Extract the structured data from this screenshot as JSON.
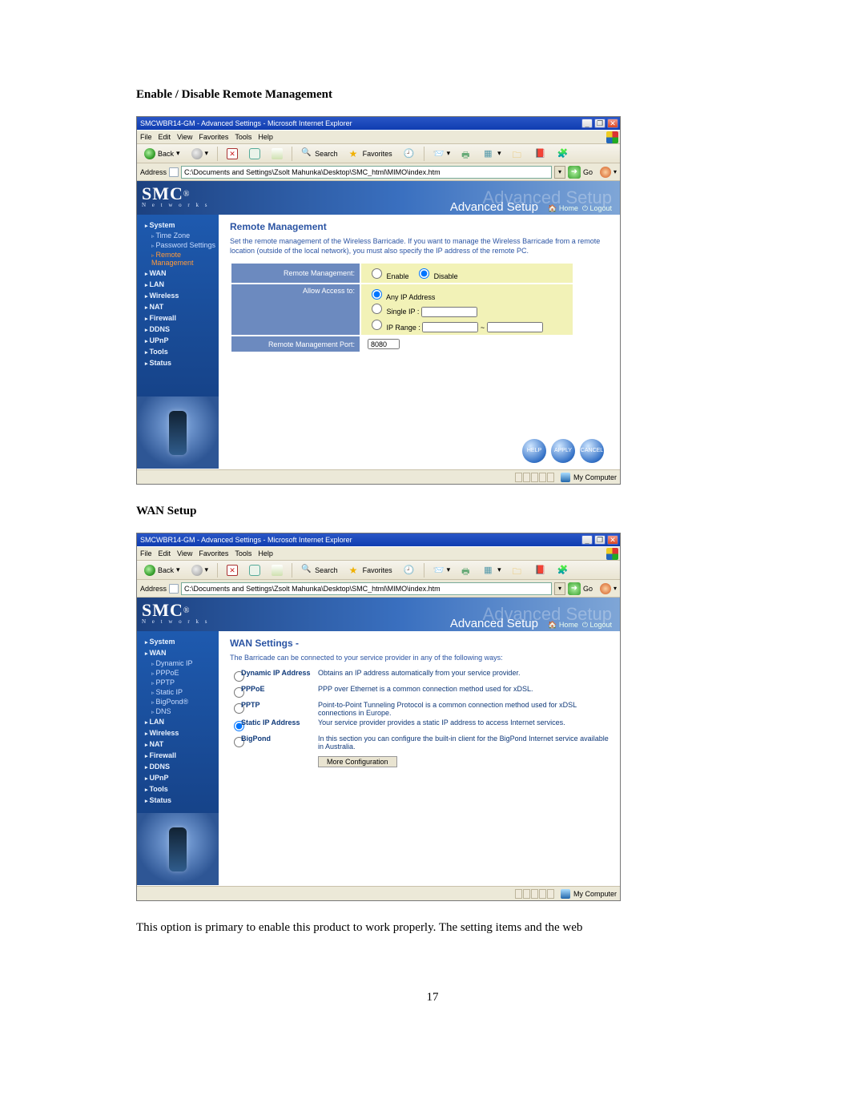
{
  "page_number": "17",
  "heading_remote": "Enable / Disable Remote Management",
  "heading_wan": "WAN Setup",
  "body_tail": "This option is primary to enable this product to work properly. The setting items and the web",
  "ie_chrome": {
    "title": "SMCWBR14-GM - Advanced Settings - Microsoft Internet Explorer",
    "menu": [
      "File",
      "Edit",
      "View",
      "Favorites",
      "Tools",
      "Help"
    ],
    "back": "Back",
    "search": "Search",
    "favorites": "Favorites",
    "addr_label": "Address",
    "addr_value": "C:\\Documents and Settings\\Zsolt Mahunka\\Desktop\\SMC_html\\MIMO\\index.htm",
    "go": "Go",
    "status_zone": "My Computer"
  },
  "smc_header": {
    "brand": "SMC",
    "brand_sub": "N e t w o r k s",
    "title": "Advanced Setup",
    "home": "Home",
    "logout": "Logout"
  },
  "sidebar_remote": {
    "items": [
      {
        "t": "sec",
        "label": "System"
      },
      {
        "t": "sub",
        "label": "Time Zone"
      },
      {
        "t": "sub",
        "label": "Password Settings"
      },
      {
        "t": "sub",
        "label": "Remote Management",
        "active": true
      },
      {
        "t": "sec",
        "label": "WAN"
      },
      {
        "t": "sec",
        "label": "LAN"
      },
      {
        "t": "sec",
        "label": "Wireless"
      },
      {
        "t": "sec",
        "label": "NAT"
      },
      {
        "t": "sec",
        "label": "Firewall"
      },
      {
        "t": "sec",
        "label": "DDNS"
      },
      {
        "t": "sec",
        "label": "UPnP"
      },
      {
        "t": "sec",
        "label": "Tools"
      },
      {
        "t": "sec",
        "label": "Status"
      }
    ]
  },
  "sidebar_wan": {
    "items": [
      {
        "t": "sec",
        "label": "System"
      },
      {
        "t": "sec",
        "label": "WAN"
      },
      {
        "t": "sub",
        "label": "Dynamic IP"
      },
      {
        "t": "sub",
        "label": "PPPoE"
      },
      {
        "t": "sub",
        "label": "PPTP"
      },
      {
        "t": "sub",
        "label": "Static IP"
      },
      {
        "t": "sub",
        "label": "BigPond®"
      },
      {
        "t": "sub",
        "label": "DNS"
      },
      {
        "t": "sec",
        "label": "LAN"
      },
      {
        "t": "sec",
        "label": "Wireless"
      },
      {
        "t": "sec",
        "label": "NAT"
      },
      {
        "t": "sec",
        "label": "Firewall"
      },
      {
        "t": "sec",
        "label": "DDNS"
      },
      {
        "t": "sec",
        "label": "UPnP"
      },
      {
        "t": "sec",
        "label": "Tools"
      },
      {
        "t": "sec",
        "label": "Status"
      }
    ]
  },
  "remote_panel": {
    "title": "Remote Management",
    "desc": "Set the remote management of the Wireless Barricade. If you want to manage the Wireless Barricade from a remote location (outside of the local network), you must also specify the IP address of the remote PC.",
    "row1_label": "Remote Management:",
    "enable": "Enable",
    "disable": "Disable",
    "row2_label": "Allow Access to:",
    "any_ip": "Any IP Address",
    "single_ip": "Single IP :",
    "ip_range": "IP Range :",
    "range_sep": "~",
    "row3_label": "Remote Management Port:",
    "port_value": "8080",
    "btn_help": "HELP",
    "btn_apply": "APPLY",
    "btn_cancel": "CANCEL"
  },
  "wan_panel": {
    "title": "WAN Settings -",
    "desc": "The Barricade can be connected to your service provider in any of the following ways:",
    "rows": [
      {
        "opt": "Dynamic IP Address",
        "desc": "Obtains an IP address automatically from your service provider."
      },
      {
        "opt": "PPPoE",
        "desc": "PPP over Ethernet is a common connection method used for xDSL."
      },
      {
        "opt": "PPTP",
        "desc": "Point-to-Point Tunneling Protocol is a common connection method used for xDSL connections in Europe."
      },
      {
        "opt": "Static IP Address",
        "desc": "Your service provider provides a static IP address to access Internet services."
      },
      {
        "opt": "BigPond",
        "desc": "In this section you can configure the built-in client for the BigPond Internet service available in Australia."
      }
    ],
    "selected_index": 3,
    "more": "More Configuration"
  }
}
